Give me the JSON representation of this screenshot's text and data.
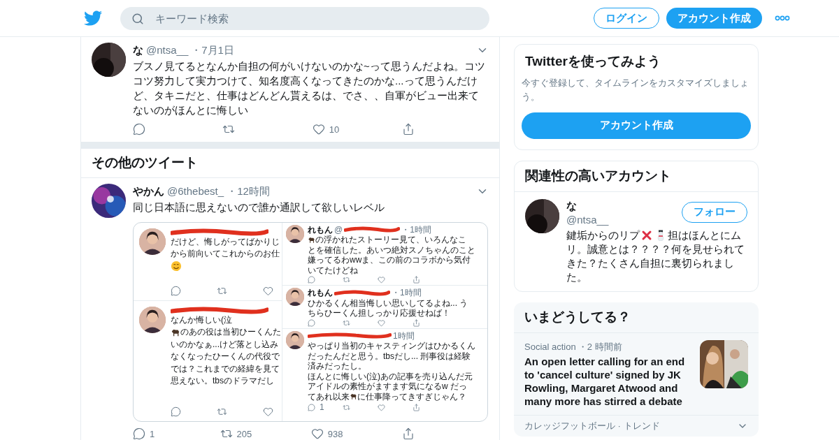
{
  "header": {
    "search_placeholder": "キーワード検索",
    "login": "ログイン",
    "signup": "アカウント作成"
  },
  "tweet": {
    "name": "な",
    "handle": "@ntsa__",
    "time": "・7月1日",
    "text": "ブスノ見てるとなんか自担の何がいけないのかな~って思うんだよね。コツコツ努力して実力つけて、知名度高くなってきたのかな...って思うんだけど、タキニだと、仕事はどんどん貰えるは、でさ、、自軍がビュー出来てないのがほんとに悔しい",
    "actions": [
      {
        "kind": "reply"
      },
      {
        "kind": "retweet"
      },
      {
        "kind": "like",
        "count": "10"
      },
      {
        "kind": "share"
      }
    ]
  },
  "section_title": "その他のツイート",
  "tweet2": {
    "name": "やかん",
    "handle": "@6thebest_",
    "time": "・12時間",
    "text": "同じ日本語に思えないので誰か通訳して欲しいレベル",
    "actions": [
      {
        "kind": "reply",
        "count": "1"
      },
      {
        "kind": "retweet",
        "count": "205"
      },
      {
        "kind": "like",
        "count": "938"
      },
      {
        "kind": "share"
      }
    ],
    "image": {
      "left": [
        {
          "lines": [
            [
              {
                "kind": "text",
                "text": "だけど、悔しがってばかりじ"
              }
            ],
            [
              {
                "kind": "text",
                "text": "から前向いてこれからのお仕"
              }
            ],
            [
              {
                "kind": "smile"
              }
            ]
          ],
          "actions": [
            {
              "kind": "reply"
            },
            {
              "kind": "retweet"
            },
            {
              "kind": "like"
            }
          ]
        },
        {
          "lines": [
            [
              {
                "kind": "text",
                "text": "なんか悔しい(泣"
              }
            ],
            [
              {
                "kind": "horse"
              },
              {
                "kind": "text",
                "text": "のあの役は当初ひーくんた"
              }
            ],
            [
              {
                "kind": "text",
                "text": "いのかなぁ...けど落とし込み"
              }
            ],
            [
              {
                "kind": "text",
                "text": "なくなったひーくんの代役で"
              }
            ],
            [
              {
                "kind": "text",
                "text": "では？これまでの経緯を見て"
              }
            ],
            [
              {
                "kind": "text",
                "text": "思えない。tbsのドラマだし"
              }
            ]
          ],
          "actions": [
            {
              "kind": "reply"
            },
            {
              "kind": "retweet"
            },
            {
              "kind": "like"
            }
          ]
        }
      ],
      "right": [
        {
          "name": "れもん",
          "handle": "@",
          "time": "・1時間",
          "lines": [
            [
              {
                "kind": "horse"
              },
              {
                "kind": "text",
                "text": "の浮かれたストーリー見て、いろんなこ"
              }
            ],
            [
              {
                "kind": "text",
                "text": "とを確信した。あいつ絶対スノちゃんのこと"
              }
            ],
            [
              {
                "kind": "text",
                "text": "嫌ってるわwwま、この前のコラボから気付"
              }
            ],
            [
              {
                "kind": "text",
                "text": "いてたけどね"
              }
            ]
          ],
          "actions": [
            {
              "kind": "reply"
            },
            {
              "kind": "retweet"
            },
            {
              "kind": "like"
            },
            {
              "kind": "share"
            }
          ]
        },
        {
          "name": "れもん",
          "time": "・1時間",
          "lines": [
            [
              {
                "kind": "text",
                "text": "ひかるくん相当悔しい思いしてるよね... う"
              }
            ],
            [
              {
                "kind": "text",
                "text": "ちらひーくん担しっかり応援せねば！"
              }
            ]
          ],
          "actions": [
            {
              "kind": "reply"
            },
            {
              "kind": "retweet"
            },
            {
              "kind": "like"
            },
            {
              "kind": "share"
            }
          ]
        },
        {
          "time": "1時間",
          "lines": [
            [
              {
                "kind": "text",
                "text": "やっぱり当初のキャスティングはひかるくん"
              }
            ],
            [
              {
                "kind": "text",
                "text": "だったんだと思う。tbsだし... 刑事役は経験"
              }
            ],
            [
              {
                "kind": "text",
                "text": "済みだったし。"
              }
            ],
            [
              {
                "kind": "text",
                "text": "ほんとに悔しい(泣)あの記事を売り込んだ元"
              }
            ],
            [
              {
                "kind": "text",
                "text": "アイドルの素性がますます気になるw だっ"
              }
            ],
            [
              {
                "kind": "text",
                "text": "てあれ以来"
              },
              {
                "kind": "horse"
              },
              {
                "kind": "text",
                "text": "に仕事降ってきすぎじゃん？"
              }
            ]
          ],
          "actions": [
            {
              "kind": "reply",
              "count": "1"
            },
            {
              "kind": "retweet"
            },
            {
              "kind": "like"
            },
            {
              "kind": "share"
            }
          ]
        }
      ]
    }
  },
  "signup_card": {
    "title": "Twitterを使ってみよう",
    "description": "今すぐ登録して、タイムラインをカスタマイズしましょう。",
    "button": "アカウント作成"
  },
  "accounts_card": {
    "title": "関連性の高いアカウント",
    "account": {
      "name": "な",
      "handle": "@ntsa__",
      "follow": "フォロー",
      "bio": [
        [
          {
            "kind": "text",
            "text": "鍵垢からのリプ"
          },
          {
            "kind": "cross"
          },
          {
            "kind": "snowman"
          },
          {
            "kind": "text",
            "text": "担はほんとにム"
          }
        ],
        [
          {
            "kind": "text",
            "text": "リ。誠意とは？？？？何を見せられて"
          }
        ],
        [
          {
            "kind": "text",
            "text": "きた？たくさん自担に裏切られまし"
          }
        ],
        [
          {
            "kind": "text",
            "text": "た。"
          }
        ]
      ]
    }
  },
  "trends_card": {
    "title": "いまどうしてる？",
    "story": {
      "category": "Social action",
      "time": "・2 時間前",
      "headline": "An open letter calling for an end to 'cancel culture' signed by JK Rowling, Margaret Atwood and many more has stirred a debate",
      "kind": "picture"
    },
    "next_item": "カレッジフットボール · トレンド"
  }
}
